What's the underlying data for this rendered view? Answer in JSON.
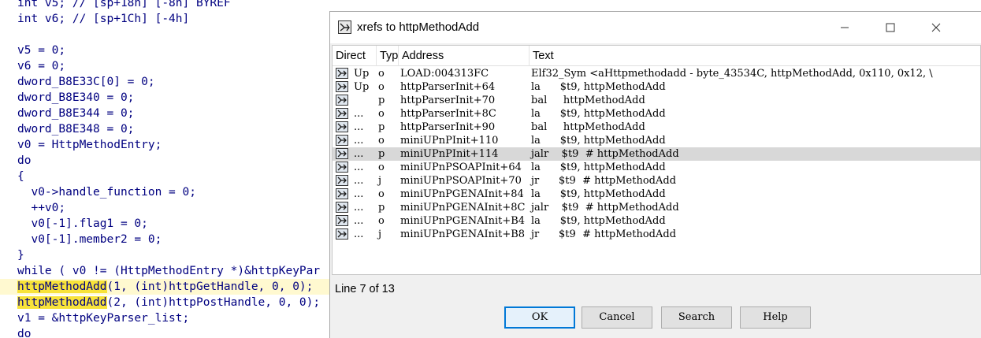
{
  "code": {
    "lines": [
      "int v5; // [sp+18h] [-8h] BYREF",
      "int v6; // [sp+1Ch] [-4h]",
      "",
      "v5 = 0;",
      "v6 = 0;",
      "dword_B8E33C[0] = 0;",
      "dword_B8E340 = 0;",
      "dword_B8E344 = 0;",
      "dword_B8E348 = 0;",
      "v0 = HttpMethodEntry;",
      "do",
      "{",
      "  v0->handle_function = 0;",
      "  ++v0;",
      "  v0[-1].flag1 = 0;",
      "  v0[-1].member2 = 0;",
      "}",
      "while ( v0 != (HttpMethodEntry *)&httpKeyPar",
      "(1, (int)httpGetHandle, 0, 0);",
      "(2, (int)httpPostHandle, 0, 0);",
      "v1 = &httpKeyParser_list;",
      "do"
    ],
    "highlight_word": "httpMethodAdd"
  },
  "dialog": {
    "title": "xrefs to httpMethodAdd",
    "columns": {
      "direction": "Direct",
      "type": "Typ",
      "address": "Address",
      "text": "Text"
    },
    "rows": [
      {
        "dir": "Up",
        "typ": "o",
        "address": "LOAD:004313FC",
        "text": "Elf32_Sym <aHttpmethodadd - byte_43534C, httpMethodAdd, 0x110, 0x12, \\"
      },
      {
        "dir": "Up",
        "typ": "o",
        "address": "httpParserInit+64",
        "text": "la      $t9, httpMethodAdd"
      },
      {
        "dir": "",
        "typ": "p",
        "address": "httpParserInit+70",
        "text": "bal     httpMethodAdd"
      },
      {
        "dir": "...",
        "typ": "o",
        "address": "httpParserInit+8C",
        "text": "la      $t9, httpMethodAdd"
      },
      {
        "dir": "...",
        "typ": "p",
        "address": "httpParserInit+90",
        "text": "bal     httpMethodAdd"
      },
      {
        "dir": "...",
        "typ": "o",
        "address": "miniUPnPInit+110",
        "text": "la      $t9, httpMethodAdd"
      },
      {
        "dir": "...",
        "typ": "p",
        "address": "miniUPnPInit+114",
        "text": "jalr    $t9  # httpMethodAdd"
      },
      {
        "dir": "...",
        "typ": "o",
        "address": "miniUPnPSOAPInit+64",
        "text": "la      $t9, httpMethodAdd"
      },
      {
        "dir": "...",
        "typ": "j",
        "address": "miniUPnPSOAPInit+70",
        "text": "jr      $t9  # httpMethodAdd"
      },
      {
        "dir": "...",
        "typ": "o",
        "address": "miniUPnPGENAInit+84",
        "text": "la      $t9, httpMethodAdd"
      },
      {
        "dir": "...",
        "typ": "p",
        "address": "miniUPnPGENAInit+8C",
        "text": "jalr    $t9  # httpMethodAdd"
      },
      {
        "dir": "...",
        "typ": "o",
        "address": "miniUPnPGENAInit+B4",
        "text": "la      $t9, httpMethodAdd"
      },
      {
        "dir": "...",
        "typ": "j",
        "address": "miniUPnPGENAInit+B8",
        "text": "jr      $t9  # httpMethodAdd"
      }
    ],
    "selected_row": 6,
    "status": "Line 7 of 13",
    "buttons": {
      "ok": "OK",
      "cancel": "Cancel",
      "search": "Search",
      "help": "Help"
    },
    "icons": {
      "title": "xref-icon",
      "row": "xref-icon"
    },
    "colors": {
      "selection": "#d8d8d8",
      "ok_border": "#0078d7",
      "code_highlight": "#f8e33a"
    }
  }
}
